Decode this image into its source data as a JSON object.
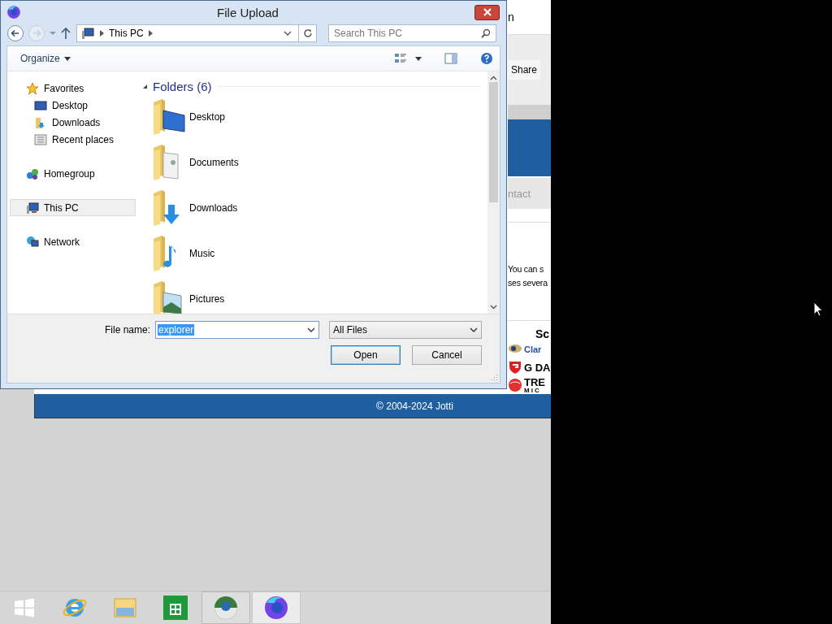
{
  "background_page": {
    "header_text": "n",
    "share_button": "Share",
    "nav_text": "ntact",
    "paragraph": [
      "You can s",
      "ses severa"
    ],
    "heading": "Sc",
    "logos": [
      {
        "kind": "eye",
        "text": "Clar"
      },
      {
        "kind": "shield",
        "text": "G DA"
      },
      {
        "kind": "ball",
        "text": "TRE",
        "subtext": "MIC"
      }
    ],
    "footer": "© 2004-2024 Jotti"
  },
  "dialog": {
    "title": "File Upload",
    "address": {
      "segments": [
        "This PC"
      ]
    },
    "search": {
      "placeholder": "Search This PC"
    },
    "toolbar": {
      "organize": "Organize"
    },
    "nav": [
      {
        "label": "Favorites",
        "selected": false,
        "children": [
          {
            "label": "Desktop",
            "selected": false
          },
          {
            "label": "Downloads",
            "selected": false
          },
          {
            "label": "Recent places",
            "selected": false
          }
        ]
      },
      {
        "label": "Homegroup",
        "selected": false
      },
      {
        "label": "This PC",
        "selected": true
      },
      {
        "label": "Network",
        "selected": false
      }
    ],
    "section": {
      "title": "Folders (6)",
      "expanded": true
    },
    "folders": [
      {
        "name": "Desktop",
        "kind": "desktop"
      },
      {
        "name": "Documents",
        "kind": "documents"
      },
      {
        "name": "Downloads",
        "kind": "downloads"
      },
      {
        "name": "Music",
        "kind": "music"
      },
      {
        "name": "Pictures",
        "kind": "pictures"
      }
    ],
    "file_name": {
      "label": "File name:",
      "value": "explorer"
    },
    "file_type": {
      "value": "All Files"
    },
    "buttons": [
      {
        "label": "Open",
        "default": true
      },
      {
        "label": "Cancel",
        "default": false
      }
    ]
  },
  "taskbar": [
    {
      "kind": "start",
      "open": false,
      "selected": false
    },
    {
      "kind": "ie",
      "open": false,
      "selected": false
    },
    {
      "kind": "explorer",
      "open": false,
      "selected": false
    },
    {
      "kind": "store",
      "open": false,
      "selected": false
    },
    {
      "kind": "sphere",
      "open": true,
      "selected": false
    },
    {
      "kind": "firefox",
      "open": true,
      "selected": true
    }
  ]
}
